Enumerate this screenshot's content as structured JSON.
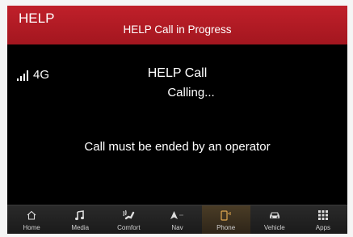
{
  "header": {
    "title": "HELP",
    "status": "HELP Call in Progress"
  },
  "status_bar": {
    "network": "4G",
    "signal_bars": 4
  },
  "call": {
    "title": "HELP Call",
    "status": "Calling...",
    "message": "Call must be ended by an operator"
  },
  "nav": {
    "items": [
      {
        "label": "Home",
        "icon": "home-icon"
      },
      {
        "label": "Media",
        "icon": "music-note-icon"
      },
      {
        "label": "Comfort",
        "icon": "comfort-icon"
      },
      {
        "label": "Nav",
        "icon": "navigation-arrow-icon"
      },
      {
        "label": "Phone",
        "icon": "phone-icon",
        "active": true
      },
      {
        "label": "Vehicle",
        "icon": "car-icon"
      },
      {
        "label": "Apps",
        "icon": "apps-grid-icon"
      }
    ]
  },
  "colors": {
    "header_red": "#b01b24",
    "active_tab": "#4a3c26",
    "phone_accent": "#d9a24a"
  }
}
